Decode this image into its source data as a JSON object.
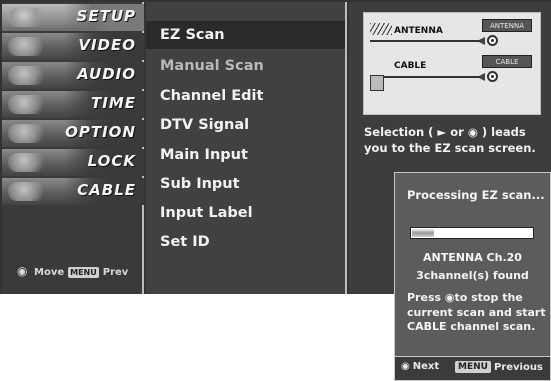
{
  "sidebar": {
    "categories": [
      {
        "label": "SETUP",
        "selected": true
      },
      {
        "label": "VIDEO",
        "selected": false
      },
      {
        "label": "AUDIO",
        "selected": false
      },
      {
        "label": "TIME",
        "selected": false
      },
      {
        "label": "OPTION",
        "selected": false
      },
      {
        "label": "LOCK",
        "selected": false
      },
      {
        "label": "CABLE",
        "selected": false
      }
    ],
    "hint_move": "Move",
    "hint_menu_chip": "MENU",
    "hint_prev": "Prev"
  },
  "menu": {
    "items": [
      {
        "label": "EZ Scan",
        "state": "selected"
      },
      {
        "label": "Manual Scan",
        "state": "dim"
      },
      {
        "label": "Channel Edit",
        "state": "normal"
      },
      {
        "label": "DTV Signal",
        "state": "normal"
      },
      {
        "label": "Main Input",
        "state": "normal"
      },
      {
        "label": "Sub Input",
        "state": "normal"
      },
      {
        "label": "Input Label",
        "state": "normal"
      },
      {
        "label": "Set ID",
        "state": "normal"
      }
    ]
  },
  "info": {
    "diagram": {
      "antenna_label": "ANTENNA",
      "cable_label": "CABLE",
      "antenna_port": "ANTENNA",
      "cable_port": "CABLE"
    },
    "description": "Selection ( ► or ◉ ) leads you to the EZ scan screen."
  },
  "popup": {
    "title": "Processing EZ scan...",
    "progress": 0.18,
    "channel_line": "ANTENNA Ch.20",
    "found_line": "3channel(s) found",
    "press_prefix": "Press ",
    "press_button": "◉",
    "press_suffix": "to stop the current scan and start CABLE channel scan.",
    "footer": {
      "next_icon": "◉",
      "next_label": "Next",
      "menu_chip": "MENU",
      "previous_label": "Previous"
    }
  },
  "colors": {
    "panel_bg": "#3d3d3d",
    "menu_bg": "#414141",
    "popup_bg": "#5c5c5c",
    "text": "#f2f2f2",
    "dim_text": "#b9b9b9"
  }
}
